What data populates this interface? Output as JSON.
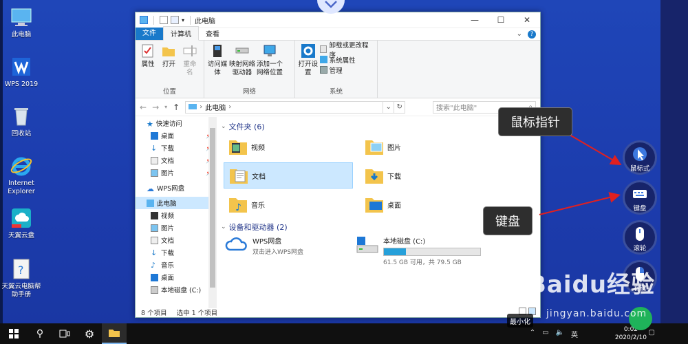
{
  "desktop": {
    "icons": [
      {
        "label": "此电脑"
      },
      {
        "label": "WPS 2019"
      },
      {
        "label": "回收站"
      },
      {
        "label": "Internet Explorer"
      },
      {
        "label": "天翼云盘"
      },
      {
        "label": "天翼云电脑帮助手册"
      }
    ]
  },
  "window": {
    "title": "此电脑",
    "tabs": {
      "file": "文件",
      "computer": "计算机",
      "view": "查看"
    },
    "ribbon": {
      "location": {
        "name": "位置",
        "properties": "属性",
        "open": "打开",
        "rename": "重命名"
      },
      "network": {
        "name": "网络",
        "media": "访问媒体",
        "map_drive": "映射网络驱动器",
        "add_location": "添加一个网络位置"
      },
      "system": {
        "name": "系统",
        "open_settings": "打开设置",
        "uninstall": "卸载或更改程序",
        "sys_props": "系统属性",
        "manage": "管理"
      }
    },
    "address": {
      "path": "此电脑",
      "search_placeholder": "搜索\"此电脑\""
    },
    "nav": {
      "quick_access": "快速访问",
      "items": [
        "桌面",
        "下载",
        "文档",
        "图片"
      ],
      "wps": "WPS网盘",
      "this_pc": "此电脑",
      "pc_items": [
        "视频",
        "图片",
        "文档",
        "下载",
        "音乐",
        "桌面",
        "本地磁盘 (C:)"
      ]
    },
    "content": {
      "folders_header": "文件夹 (6)",
      "folders": [
        "视频",
        "图片",
        "文档",
        "下载",
        "音乐",
        "桌面"
      ],
      "devices_header": "设备和驱动器 (2)",
      "wps_drive": {
        "name": "WPS网盘",
        "desc": "双击进入WPS网盘"
      },
      "local_disk": {
        "name": "本地磁盘 (C:)",
        "free": "61.5 GB 可用，共 79.5 GB",
        "used_fraction": 0.226
      }
    },
    "status": {
      "count": "8 个项目",
      "selected": "选中 1 个项目"
    }
  },
  "callouts": {
    "pointer": "鼠标指针",
    "keyboard": "键盘"
  },
  "floating": {
    "mouse_mode": "鼠标式",
    "keyboard": "键盘",
    "wheel": "滚轮",
    "right_click": "右键"
  },
  "overlay": {
    "minimize": "最小化",
    "watermark": "Baidu经验",
    "watermark_sub": "jingyan.baidu.com"
  },
  "taskbar": {
    "time": "0:02",
    "date": "2020/2/10",
    "ime": "英"
  }
}
